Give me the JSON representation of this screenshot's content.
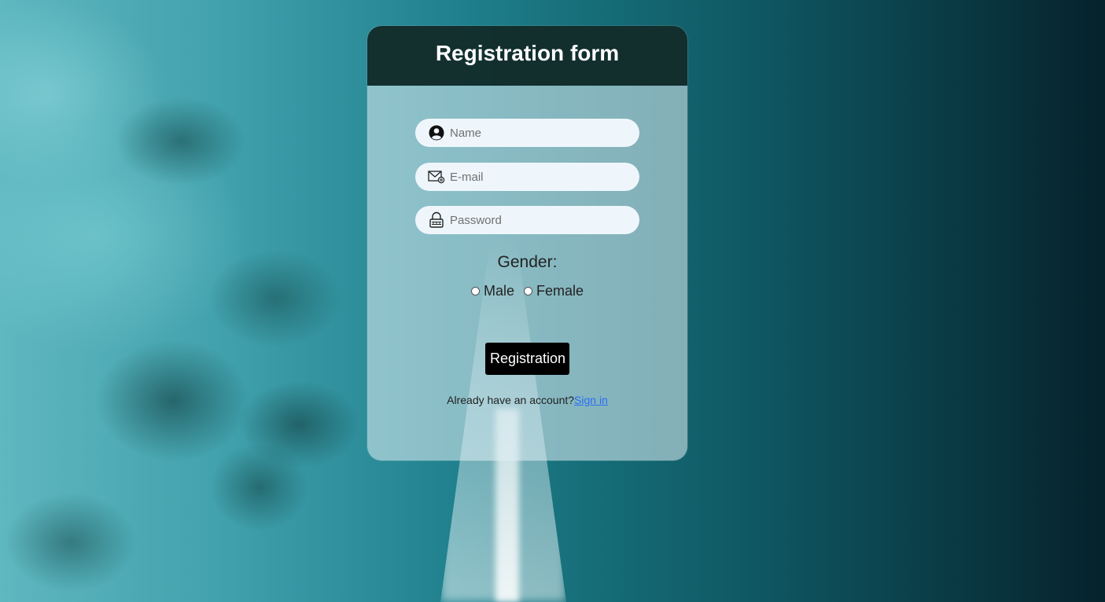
{
  "form": {
    "title": "Registration form",
    "name_placeholder": "Name",
    "email_placeholder": "E-mail",
    "password_placeholder": "Password",
    "gender_label": "Gender:",
    "gender_options": [
      "Male",
      "Female"
    ],
    "submit_label": "Registration",
    "signin_prompt": "Already have an account?",
    "signin_link": "Sign in"
  },
  "icons": {
    "name": "user-icon",
    "email": "envelope-icon",
    "password": "lock-icon"
  },
  "colors": {
    "header_bg": "#06201e",
    "button_bg": "#000000",
    "link": "#2a6df5",
    "field_bg": "#eef6fc"
  }
}
